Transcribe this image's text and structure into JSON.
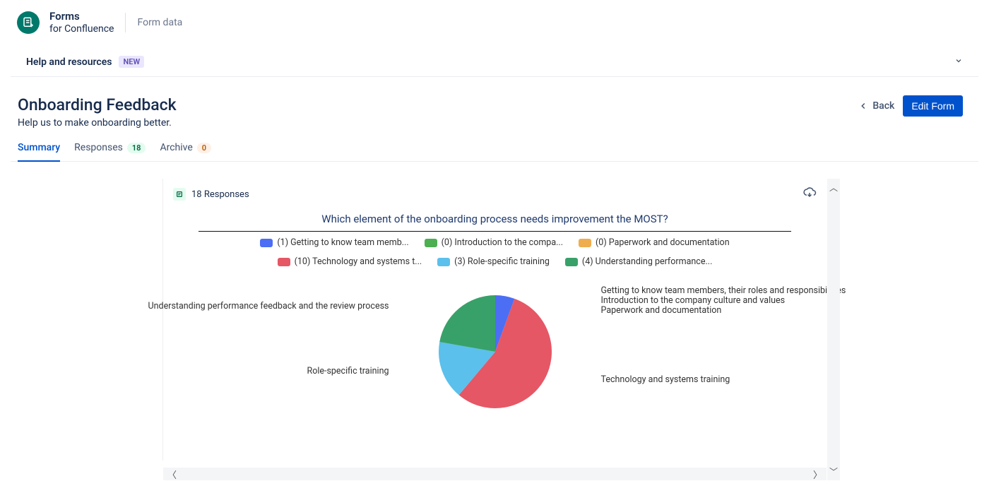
{
  "app": {
    "title": "Forms",
    "subtitle": "for Confluence"
  },
  "breadcrumb": "Form data",
  "help": {
    "label": "Help and resources",
    "badge": "NEW"
  },
  "page": {
    "title": "Onboarding Feedback",
    "description": "Help us to make onboarding better."
  },
  "actions": {
    "back": "Back",
    "edit": "Edit Form"
  },
  "tabs": {
    "summary": {
      "label": "Summary"
    },
    "responses": {
      "label": "Responses",
      "count": "18"
    },
    "archive": {
      "label": "Archive",
      "count": "0"
    }
  },
  "summaryCard": {
    "responses_text": "18 Responses",
    "question": "Which element of the onboarding process needs improvement the MOST?"
  },
  "chart_data": {
    "type": "pie",
    "title": "Which element of the onboarding process needs improvement the MOST?",
    "categories": [
      "Getting to know team members, their roles and responsibilities",
      "Introduction to the company culture and values",
      "Paperwork and documentation",
      "Technology and systems training",
      "Role-specific training",
      "Understanding performance feedback and the review process"
    ],
    "values": [
      1,
      0,
      0,
      10,
      3,
      4
    ],
    "colors": [
      "#4C6EF5",
      "#4CAF50",
      "#F0AD4E",
      "#E55765",
      "#5BC0EB",
      "#38A169"
    ],
    "legend_labels": [
      "(1) Getting to know team memb...",
      "(0) Introduction to the compa...",
      "(0) Paperwork and documentation",
      "(10) Technology and systems t...",
      "(3) Role-specific training",
      "(4) Understanding performance..."
    ],
    "callout_labels": [
      "Getting to know team members, their roles and responsibilities",
      "Introduction to the company culture and values",
      "Paperwork and documentation",
      "Technology and systems training",
      "Role-specific training",
      "Understanding performance feedback and the review process"
    ]
  }
}
